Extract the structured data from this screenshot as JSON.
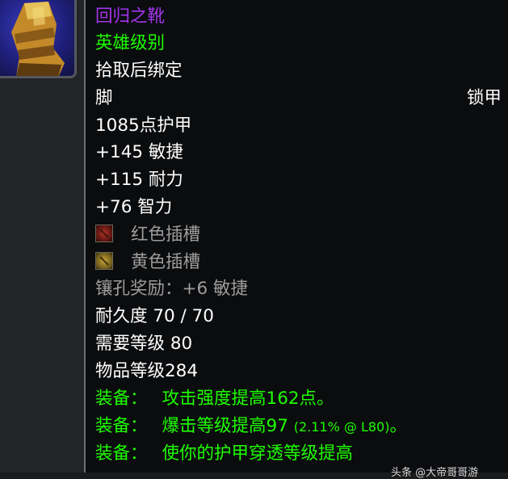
{
  "item": {
    "name": "回归之靴",
    "quality": "英雄级别",
    "binding": "拾取后绑定",
    "slot": "脚",
    "armor_type": "锁甲",
    "armor": "1085点护甲",
    "stats": [
      "+145 敏捷",
      "+115 耐力",
      "+76 智力"
    ],
    "sockets": [
      {
        "label": "红色插槽",
        "icon": "red-socket-icon",
        "color": "#b53128"
      },
      {
        "label": "黄色插槽",
        "icon": "yellow-socket-icon",
        "color": "#c9a63a"
      }
    ],
    "socket_bonus": "镶孔奖励：+6 敏捷",
    "durability": "耐久度 70 / 70",
    "required_level": "需要等级 80",
    "item_level": "物品等级284",
    "equip_effects": [
      {
        "prefix": "装备：",
        "text": "攻击强度提高162点。",
        "extra": ""
      },
      {
        "prefix": "装备：",
        "text": "爆击等级提高97",
        "extra": "(2.11% @ L80)",
        "suffix": "。"
      },
      {
        "prefix": "装备：",
        "text": "使你的护甲穿透等级提高",
        "extra": ""
      }
    ]
  },
  "icon": {
    "name": "boots-icon"
  },
  "watermark": "头条 @大帝哥哥游"
}
